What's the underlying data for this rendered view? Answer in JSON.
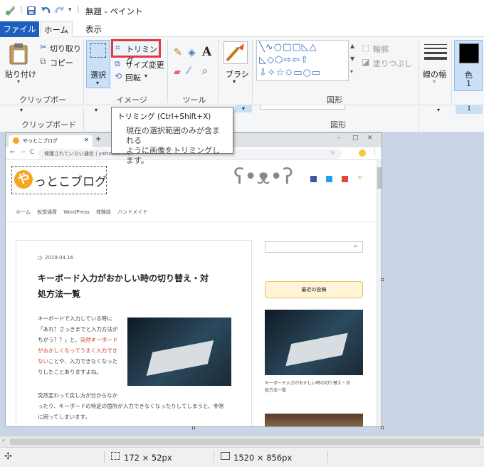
{
  "window": {
    "title": "無題 - ペイント"
  },
  "tabs": {
    "file": "ファイル",
    "home": "ホーム",
    "view": "表示"
  },
  "clipboard": {
    "paste": "貼り付け",
    "cut": "切り取り",
    "copy": "コピー",
    "group": "クリップボード"
  },
  "image": {
    "select": "選択",
    "crop": "トリミング",
    "resize": "サイズ変更",
    "rotate": "回転",
    "group": "イメージ"
  },
  "tools": {
    "group": "ツール",
    "brush": "ブラシ"
  },
  "shapes": {
    "group": "図形",
    "outline": "輪郭",
    "fill": "塗りつぶし"
  },
  "size": {
    "label": "線の幅"
  },
  "color": {
    "label": "色",
    "num": "1"
  },
  "ghost": {
    "clipboard": "クリップボード",
    "shapes": "図形",
    "num": "1"
  },
  "tooltip": {
    "title": "トリミング (Ctrl+Shift+X)",
    "desc1": "現在の選択範囲のみが含まれる",
    "desc2": "ように画像をトリミングします。"
  },
  "status": {
    "selection": "172 × 52px",
    "image": "1520 × 856px"
  },
  "colors": {
    "accent": "#1e5ebd",
    "highlight": "#e0393e"
  },
  "browser": {
    "tab": "やっとこブログ",
    "url": "保護されていない通信 | yattokoo.com",
    "logo_rest": "っとこブログ",
    "logo_first": "や"
  },
  "blog": {
    "nav": [
      "ホーム",
      "仮想通貨",
      "WordPress",
      "体験談",
      "ハンドメイド"
    ],
    "date": "2019.04.16",
    "title1": "キーボード入力がおかしい時の切り替え・対",
    "title2": "処方法一覧",
    "p1": "キーボードで入力している時に",
    "p2": "「あれ？さっきまでと入力方法が",
    "p3": "ちがう？？」と、",
    "p3red": "突然キーボード",
    "p4red": "がおかしくなってうまく入力でき",
    "p5red": "ない",
    "p5": "ことや、入力できなくなった",
    "p6": "りしたことありますよね。",
    "p7": "突然変わって戻し方が分からなか",
    "p8": "ったり、キーボードの特定の箇所が入力できなくなったりしてしまうと、非常",
    "p9": "に困ってしまいます。",
    "recent": "最近の投稿",
    "side_caption1": "キーボード入力がおかしい時の切り替え・対",
    "side_caption2": "処方法一覧"
  }
}
